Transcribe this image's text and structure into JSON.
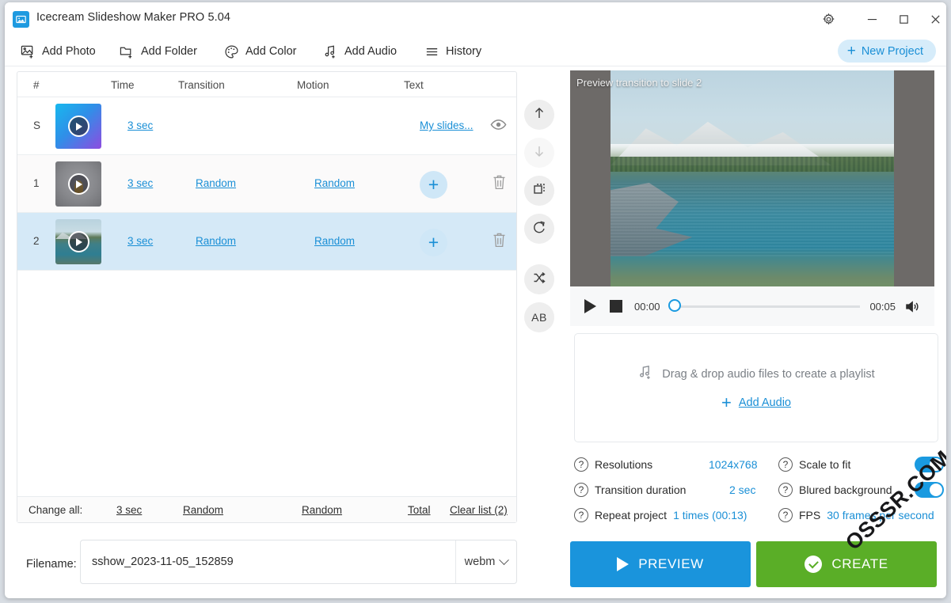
{
  "window": {
    "title": "Icecream Slideshow Maker PRO 5.04",
    "app_icon": "photo-icon",
    "controls": {
      "settings": "gear-icon",
      "minimize": "minimize-icon",
      "maximize": "maximize-icon",
      "close": "close-icon"
    }
  },
  "toolbar": {
    "items": [
      {
        "label": "Add Photo",
        "icon": "add-photo-icon"
      },
      {
        "label": "Add Folder",
        "icon": "add-folder-icon"
      },
      {
        "label": "Add Color",
        "icon": "palette-icon"
      },
      {
        "label": "Add Audio",
        "icon": "add-audio-icon"
      },
      {
        "label": "History",
        "icon": "hamburger-icon"
      }
    ],
    "new_project": "New Project"
  },
  "slide_list": {
    "columns": [
      "#",
      "Time",
      "Transition",
      "Motion",
      "Text"
    ],
    "rows": [
      {
        "index": "S",
        "time": "3 sec",
        "transition": "",
        "motion": "",
        "text": "My slides...",
        "action": "eye-icon",
        "thumb": "gradient"
      },
      {
        "index": "1",
        "time": "3 sec",
        "transition": "Random",
        "motion": "Random",
        "text": "",
        "action": "trash-icon",
        "thumb": "dark"
      },
      {
        "index": "2",
        "time": "3 sec",
        "transition": "Random",
        "motion": "Random",
        "text": "",
        "action": "trash-icon",
        "thumb": "lake"
      }
    ],
    "change_all": {
      "label": "Change all:",
      "time": "3 sec",
      "transition": "Random",
      "motion": "Random",
      "total": "Total",
      "clear_list": "Clear list (2)"
    }
  },
  "tools": [
    {
      "name": "move-up-icon",
      "enabled": true
    },
    {
      "name": "move-down-icon",
      "enabled": false
    },
    {
      "name": "crop-icon",
      "enabled": true
    },
    {
      "name": "rotate-icon",
      "enabled": true
    },
    {
      "name": "shuffle-icon",
      "enabled": true
    },
    {
      "name": "sort-ab-icon",
      "enabled": true,
      "label": "AB"
    }
  ],
  "filename": {
    "label": "Filename:",
    "value": "sshow_2023-11-05_152859",
    "placeholder": "sshow_2023-11-05_152859",
    "format": "webm"
  },
  "preview": {
    "caption": "Preview transition to slide 2",
    "play": "play-icon",
    "stop": "stop-icon",
    "current_time": "00:00",
    "total_time": "00:05",
    "volume": "volume-icon"
  },
  "audio": {
    "drop_text": "Drag & drop audio files to create a playlist",
    "add_link": "Add Audio",
    "icon": "music-note-add-icon"
  },
  "settings": {
    "resolutions": {
      "label": "Resolutions",
      "value": "1024x768"
    },
    "transition_duration": {
      "label": "Transition duration",
      "value": "2 sec"
    },
    "repeat_project": {
      "label": "Repeat project",
      "value": "1 times (00:13)"
    },
    "scale_to_fit": {
      "label": "Scale to fit",
      "value": "on"
    },
    "blured_background": {
      "label": "Blured background",
      "value": "on"
    },
    "fps": {
      "label": "FPS",
      "value": "30 frames per second"
    },
    "help_icon": "question-mark-icon"
  },
  "actions": {
    "preview": "PREVIEW",
    "create": "CREATE"
  },
  "watermark": "OSSSR.COM",
  "colors": {
    "accent": "#1a8fd6",
    "preview_button": "#1a94dc",
    "create_button": "#5aae27",
    "selected_row": "#d5e9f7"
  }
}
